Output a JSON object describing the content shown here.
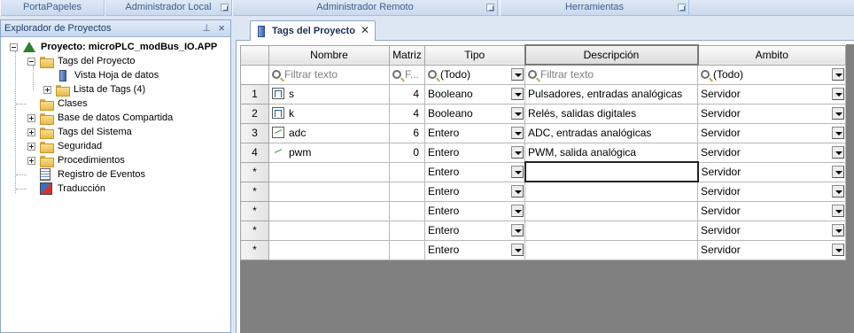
{
  "ribbon": {
    "groups": [
      "PortaPapeles",
      "Administrador Local",
      "Administrador Remoto",
      "Herramientas"
    ]
  },
  "explorer": {
    "title": "Explorador de Proyectos",
    "project": "Proyecto: microPLC_modBus_IO.APP",
    "tags_proyecto": "Tags del Proyecto",
    "vista_hoja": "Vista Hoja de datos",
    "lista_tags": "Lista de Tags (4)",
    "clases": "Clases",
    "base_datos": "Base de datos Compartida",
    "tags_sistema": "Tags del Sistema",
    "seguridad": "Seguridad",
    "procedimientos": "Procedimientos",
    "registro": "Registro de Eventos",
    "traduccion": "Traducción"
  },
  "tab": {
    "label": "Tags del Proyecto"
  },
  "grid": {
    "headers": {
      "nombre": "Nombre",
      "matriz": "Matriz",
      "tipo": "Tipo",
      "descripcion": "Descripción",
      "ambito": "Ambito"
    },
    "filter": {
      "nombre": "Filtrar texto",
      "matriz": "F...",
      "tipo": "(Todo)",
      "descripcion": "Filtrar texto",
      "ambito": "(Todo)"
    },
    "rows": [
      {
        "num": "1",
        "nombre": "s",
        "matriz": "4",
        "tipo": "Booleano",
        "descripcion": "Pulsadores, entradas analógicas",
        "ambito": "Servidor",
        "icon": "bool"
      },
      {
        "num": "2",
        "nombre": "k",
        "matriz": "4",
        "tipo": "Booleano",
        "descripcion": "Relés, salidas digitales",
        "ambito": "Servidor",
        "icon": "bool"
      },
      {
        "num": "3",
        "nombre": "adc",
        "matriz": "6",
        "tipo": "Entero",
        "descripcion": "ADC, entradas analógicas",
        "ambito": "Servidor",
        "icon": "int"
      },
      {
        "num": "4",
        "nombre": "pwm",
        "matriz": "0",
        "tipo": "Entero",
        "descripcion": "PWM, salida analógica",
        "ambito": "Servidor",
        "icon": "int-plain"
      }
    ],
    "new_rows": [
      {
        "num": "*",
        "tipo": "Entero",
        "ambito": "Servidor"
      },
      {
        "num": "*",
        "tipo": "Entero",
        "ambito": "Servidor"
      },
      {
        "num": "*",
        "tipo": "Entero",
        "ambito": "Servidor"
      },
      {
        "num": "*",
        "tipo": "Entero",
        "ambito": "Servidor"
      },
      {
        "num": "*",
        "tipo": "Entero",
        "ambito": "Servidor"
      }
    ]
  }
}
